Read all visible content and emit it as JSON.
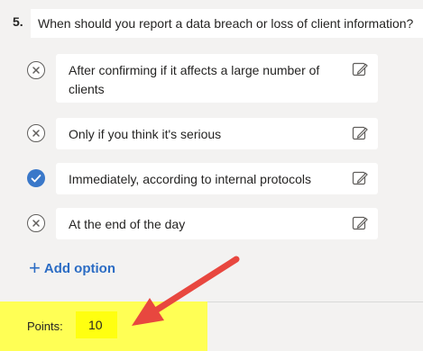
{
  "question": {
    "number": "5.",
    "text": "When should you report a data breach or loss of client information?"
  },
  "options": [
    {
      "label": "After confirming if it affects a large number of clients",
      "correct": false,
      "icon": "x-circle-icon"
    },
    {
      "label": "Only if you think it's serious",
      "correct": false,
      "icon": "x-circle-icon"
    },
    {
      "label": "Immediately, according to internal protocols",
      "correct": true,
      "icon": "check-circle-icon"
    },
    {
      "label": "At the end of the day",
      "correct": false,
      "icon": "x-circle-icon"
    }
  ],
  "add_option": {
    "icon": "plus-icon",
    "label": "Add option"
  },
  "points": {
    "label": "Points:",
    "value": "10"
  },
  "colors": {
    "accent": "#2b6cc4",
    "correct_icon": "#3a78c9",
    "highlight": "#ffff55",
    "arrow": "#e8473f"
  }
}
